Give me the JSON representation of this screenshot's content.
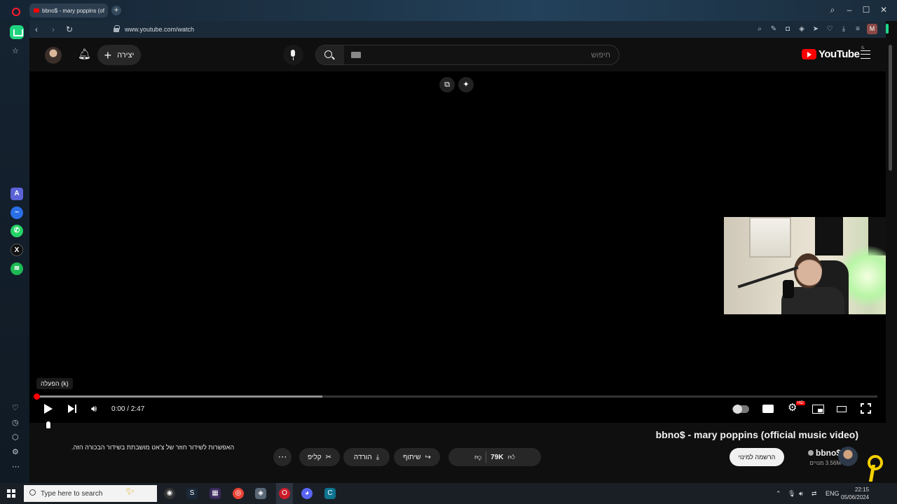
{
  "browser": {
    "tab_title": "bbno$ - mary poppins (of",
    "url": "www.youtube.com/watch",
    "profile_initial": "M",
    "sidebar_apps": [
      "aria-icon",
      "messenger-icon",
      "whatsapp-icon",
      "x-icon",
      "spotify-icon"
    ]
  },
  "youtube": {
    "logo_text": "YouTube",
    "region": "IL",
    "search_placeholder": "חיפוש",
    "create_label": "יצירה",
    "video": {
      "tooltip": "הפעלה (k)",
      "time": "0:00 / 2:47",
      "progress_buffered": 0.34,
      "title": "bbno$ - mary poppins (official music video)",
      "notice": "האפשרות לשידור חוזר של צ'אט מושבתת בשידור הבכורה הזה.",
      "actions": {
        "clip": "קליפ",
        "download": "הורדה",
        "share": "שיתוף",
        "likes": "79K"
      },
      "channel": {
        "name": "bbno$",
        "subscribers": "3.56M מנויים",
        "subscribe_label": "הרשמה למינוי"
      }
    }
  },
  "taskbar": {
    "search_text": "Type here to search",
    "lang": "ENG",
    "time": "22:15",
    "date": "05/06/2024"
  },
  "colors": {
    "yt_red": "#ff0000",
    "opera_red": "#ff1b2d",
    "opera_green": "#1fd37f",
    "yt_bg": "#0f0f0f"
  }
}
